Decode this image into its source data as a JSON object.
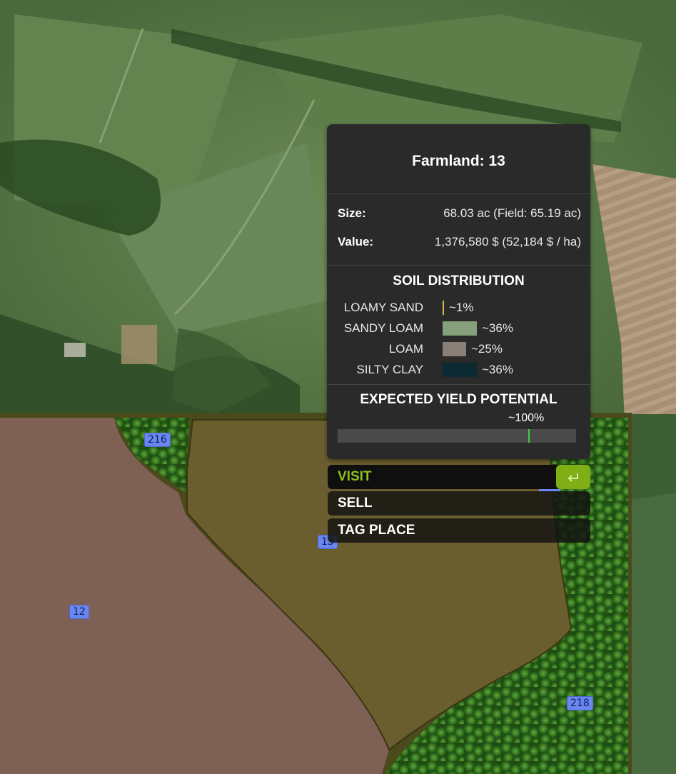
{
  "farmland": {
    "title": "Farmland: 13",
    "size_label": "Size:",
    "size_value": "68.03 ac (Field: 65.19 ac)",
    "value_label": "Value:",
    "value_value": "1,376,580 $ (52,184 $ / ha)"
  },
  "soil": {
    "heading": "SOIL DISTRIBUTION",
    "items": [
      {
        "name": "LOAMY SAND",
        "pct": "~1%",
        "fraction": 0.01,
        "color": "#d9b84a"
      },
      {
        "name": "SANDY LOAM",
        "pct": "~36%",
        "fraction": 0.36,
        "color": "#86a07c"
      },
      {
        "name": "LOAM",
        "pct": "~25%",
        "fraction": 0.25,
        "color": "#8a7f76"
      },
      {
        "name": "SILTY CLAY",
        "pct": "~36%",
        "fraction": 0.36,
        "color": "#0b2a31"
      }
    ]
  },
  "yield": {
    "heading": "EXPECTED YIELD POTENTIAL",
    "pct": "~100%",
    "fraction": 0.8,
    "marker_color": "#3ed04a"
  },
  "menu": {
    "visit": "VISIT",
    "sell": "SELL",
    "tag_place": "TAG PLACE",
    "enter_icon": "enter-key-icon"
  },
  "plots": {
    "p216": "216",
    "p13": "13",
    "p12": "12",
    "p218": "218"
  },
  "colors": {
    "accent": "#8ec21f",
    "owned_field": "#7e6154",
    "selected_field": "#6b5e2e",
    "forest": "#2f6a1f"
  }
}
